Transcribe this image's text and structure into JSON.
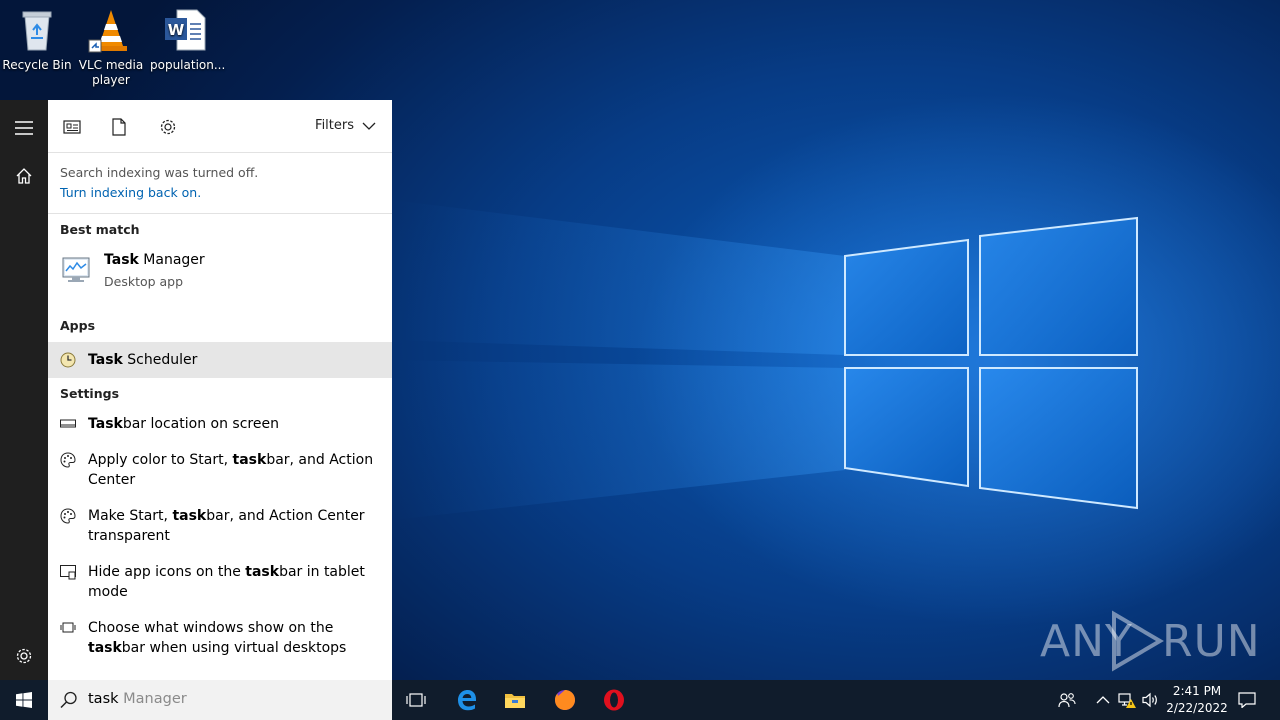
{
  "desktop": {
    "icons": [
      {
        "label": "Recycle Bin"
      },
      {
        "label": "VLC media player"
      },
      {
        "label": "population..."
      }
    ],
    "watermark": {
      "left": "ANY",
      "right": "RUN"
    }
  },
  "search_panel": {
    "scopes": [
      "apps-scope-icon",
      "documents-scope-icon",
      "settings-scope-icon"
    ],
    "filters_label": "Filters",
    "notice": {
      "message": "Search indexing was turned off.",
      "link": "Turn indexing back on."
    },
    "best_match": {
      "heading": "Best match",
      "title_bold": "Task",
      "title_rest": " Manager",
      "subtitle": "Desktop app"
    },
    "apps": {
      "heading": "Apps",
      "items": [
        {
          "bold": "Task",
          "rest": " Scheduler",
          "selected": true
        }
      ]
    },
    "settings": {
      "heading": "Settings",
      "items": [
        {
          "pre": "",
          "bold": "Task",
          "post": "bar location on screen"
        },
        {
          "pre": "Apply color to Start, ",
          "bold": "task",
          "post": "bar, and Action Center"
        },
        {
          "pre": "Make Start, ",
          "bold": "task",
          "post": "bar, and Action Center transparent"
        },
        {
          "pre": "Hide app icons on the ",
          "bold": "task",
          "post": "bar in tablet mode"
        },
        {
          "pre": "Choose what windows show on the ",
          "bold": "task",
          "post": "bar when using virtual desktops"
        }
      ]
    },
    "search_box": {
      "typed": "task",
      "suggestion": " Manager"
    }
  },
  "taskbar": {
    "pinned": [
      "task-view-icon",
      "edge-icon",
      "file-explorer-icon",
      "firefox-icon",
      "opera-icon"
    ],
    "clock": {
      "time": "2:41 PM",
      "date": "2/22/2022"
    }
  }
}
